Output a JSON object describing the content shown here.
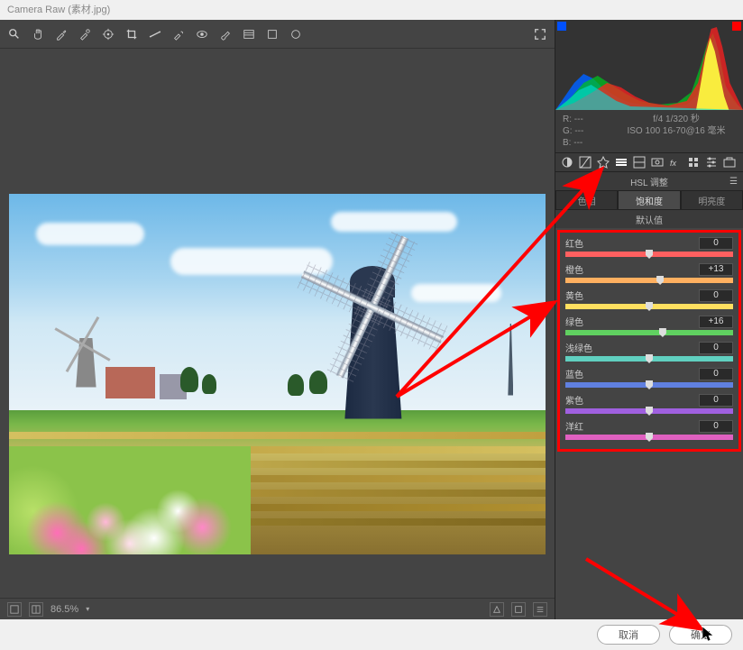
{
  "window": {
    "title": "Camera Raw (素材.jpg)"
  },
  "toolbar": {
    "tools": [
      "zoom",
      "hand",
      "eyedropper",
      "color-sampler",
      "target-adjust",
      "crop",
      "straighten",
      "spot-removal",
      "redeye",
      "adjustment-brush",
      "graduated-filter",
      "radial-filter",
      "rotate-ccw"
    ],
    "fullscreen": "fullscreen"
  },
  "info": {
    "rgb": {
      "r_label": "R:",
      "g_label": "G:",
      "b_label": "B:",
      "r": "---",
      "g": "---",
      "b": "---"
    },
    "exif": {
      "line1": "f/4  1/320 秒",
      "line2": "ISO 100  16-70@16 毫米"
    }
  },
  "panel": {
    "title": "HSL 调整",
    "tabs": {
      "hue": "色相",
      "saturation": "饱和度",
      "luminance": "明亮度"
    },
    "default_label": "默认值"
  },
  "sliders": [
    {
      "key": "red",
      "label": "红色",
      "value": "0",
      "pos": 50,
      "gradient": "linear-gradient(to right,#ff6060,#ff6060)"
    },
    {
      "key": "orange",
      "label": "橙色",
      "value": "+13",
      "pos": 56.5,
      "gradient": "linear-gradient(to right,#ffb060,#ffb060)"
    },
    {
      "key": "yellow",
      "label": "黄色",
      "value": "0",
      "pos": 50,
      "gradient": "linear-gradient(to right,#ffe060,#ffe060)"
    },
    {
      "key": "green",
      "label": "绿色",
      "value": "+16",
      "pos": 58,
      "gradient": "linear-gradient(to right,#60d060,#60d060)"
    },
    {
      "key": "aqua",
      "label": "浅绿色",
      "value": "0",
      "pos": 50,
      "gradient": "linear-gradient(to right,#60d0c0,#60d0c0)"
    },
    {
      "key": "blue",
      "label": "蓝色",
      "value": "0",
      "pos": 50,
      "gradient": "linear-gradient(to right,#6080e0,#6080e0)"
    },
    {
      "key": "purple",
      "label": "紫色",
      "value": "0",
      "pos": 50,
      "gradient": "linear-gradient(to right,#a060e0,#a060e0)"
    },
    {
      "key": "magenta",
      "label": "洋红",
      "value": "0",
      "pos": 50,
      "gradient": "linear-gradient(to right,#e060c0,#e060c0)"
    }
  ],
  "statusbar": {
    "zoom": "86.5%"
  },
  "footer": {
    "cancel": "取消",
    "ok": "确定"
  }
}
